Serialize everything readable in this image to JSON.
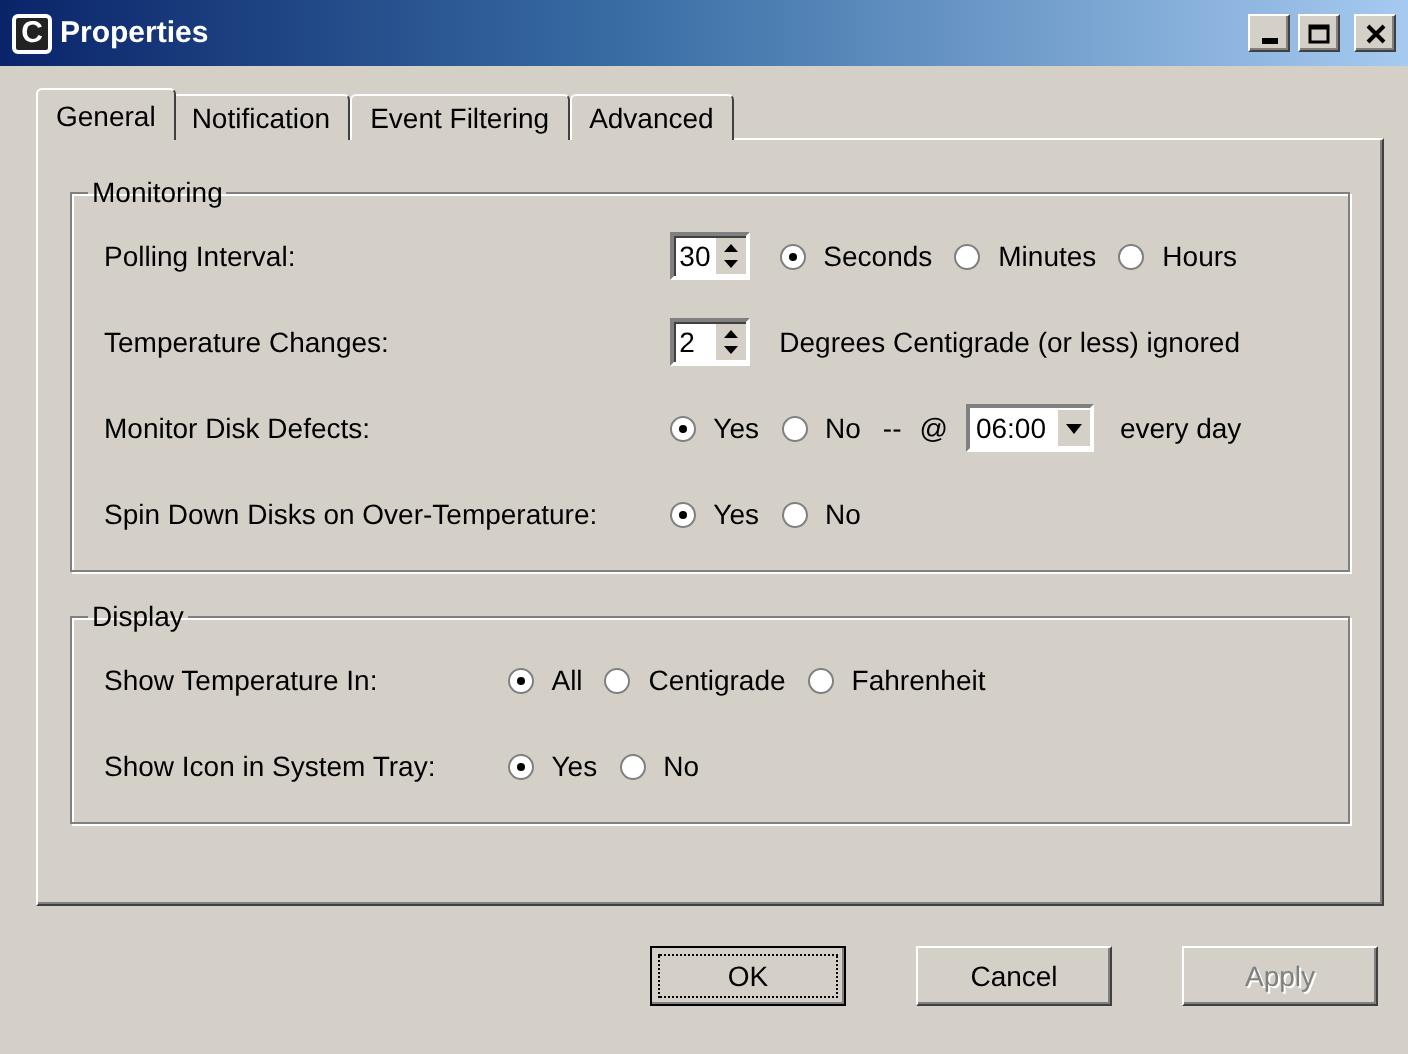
{
  "window": {
    "icon_letter": "C",
    "title": "Properties",
    "controls": [
      {
        "kind": "minimize"
      },
      {
        "kind": "maximize"
      },
      {
        "kind": "close"
      }
    ]
  },
  "tabs": [
    {
      "label": "General",
      "selected": true
    },
    {
      "label": "Notification",
      "selected": false
    },
    {
      "label": "Event Filtering",
      "selected": false
    },
    {
      "label": "Advanced",
      "selected": false
    }
  ],
  "groups": [
    {
      "title": "Monitoring",
      "rows": [
        {
          "label": "Polling Interval:",
          "items": [
            {
              "kind": "spin",
              "value": "30"
            },
            {
              "kind": "radio",
              "label": "Seconds",
              "selected": true
            },
            {
              "kind": "radio",
              "label": "Minutes",
              "selected": false
            },
            {
              "kind": "radio",
              "label": "Hours",
              "selected": false
            }
          ]
        },
        {
          "label": "Temperature Changes:",
          "items": [
            {
              "kind": "spin",
              "value": "2"
            },
            {
              "kind": "text",
              "label": "Degrees Centigrade (or less) ignored"
            }
          ]
        },
        {
          "label": "Monitor Disk Defects:",
          "items": [
            {
              "kind": "radio",
              "label": "Yes",
              "selected": true
            },
            {
              "kind": "radio",
              "label": "No",
              "selected": false
            },
            {
              "kind": "text",
              "label": "--"
            },
            {
              "kind": "text",
              "label": "@"
            },
            {
              "kind": "dropdown",
              "value": "06:00"
            },
            {
              "kind": "text",
              "label": "every day"
            }
          ]
        },
        {
          "label": "Spin Down Disks on Over-Temperature:",
          "items": [
            {
              "kind": "radio",
              "label": "Yes",
              "selected": true
            },
            {
              "kind": "radio",
              "label": "No",
              "selected": false
            }
          ]
        }
      ]
    },
    {
      "title": "Display",
      "rows": [
        {
          "label": "Show Temperature In:",
          "items": [
            {
              "kind": "radio",
              "label": "All",
              "selected": true
            },
            {
              "kind": "radio",
              "label": "Centigrade",
              "selected": false
            },
            {
              "kind": "radio",
              "label": "Fahrenheit",
              "selected": false
            }
          ]
        },
        {
          "label": "Show Icon in System Tray:",
          "items": [
            {
              "kind": "radio",
              "label": "Yes",
              "selected": true
            },
            {
              "kind": "radio",
              "label": "No",
              "selected": false
            }
          ]
        }
      ]
    }
  ],
  "buttons": [
    {
      "label": "OK",
      "default": true,
      "disabled": false
    },
    {
      "label": "Cancel",
      "default": false,
      "disabled": false
    },
    {
      "label": "Apply",
      "default": false,
      "disabled": true
    }
  ]
}
